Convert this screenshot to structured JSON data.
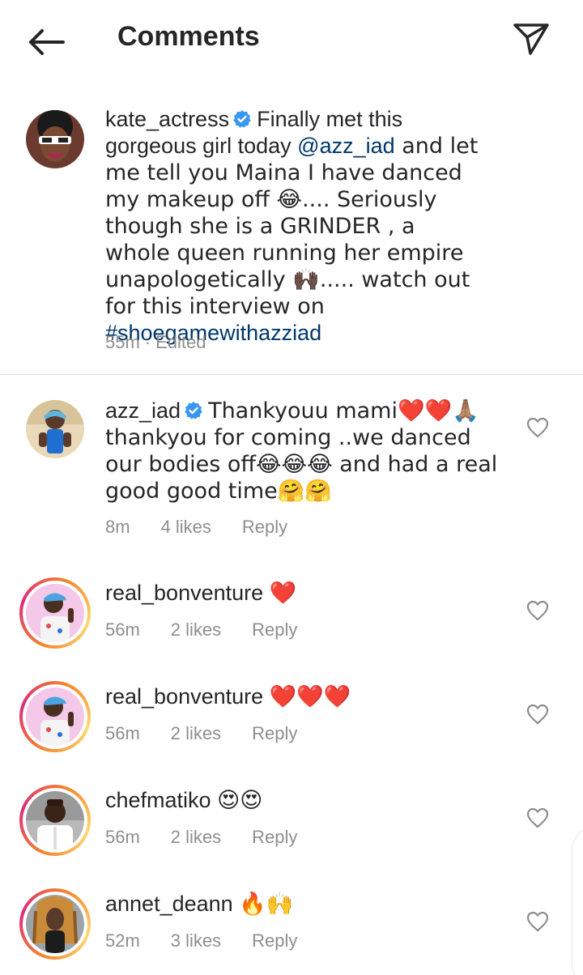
{
  "header": {
    "title": "Comments",
    "back_icon": "arrow-left-icon",
    "share_icon": "paper-plane-icon"
  },
  "caption": {
    "username": "kate_actress",
    "verified": true,
    "text_1": "Finally  met this gorgeous girl today ",
    "mention": "@azz_iad",
    "text_2": " and let me tell you Maina I have danced my makeup off 😂.... Seriously though she is a GRINDER , a whole queen running her empire unapologetically 🙌🏿..... watch out for this interview on ",
    "hashtag": "#shoegamewithazziad",
    "time": "55m",
    "edited": "Edited"
  },
  "comments": [
    {
      "username": "azz_iad",
      "verified": true,
      "text": "Thankyouu mami❤️❤️🙏🏽 thankyou for coming ..we danced our bodies off😂😂😂 and had a real good good time🤗🤗",
      "time": "8m",
      "likes": "4 likes",
      "reply": "Reply"
    },
    {
      "username": "real_bonventure",
      "text": "❤️",
      "time": "56m",
      "likes": "2 likes",
      "reply": "Reply"
    },
    {
      "username": "real_bonventure",
      "text": "❤️❤️❤️",
      "time": "56m",
      "likes": "2 likes",
      "reply": "Reply"
    },
    {
      "username": "chefmatiko",
      "text": "😍😍",
      "time": "56m",
      "likes": "2 likes",
      "reply": "Reply"
    },
    {
      "username": "annet_deann",
      "text": "🔥🙌",
      "time": "52m",
      "likes": "3 likes",
      "reply": "Reply"
    }
  ],
  "colors": {
    "text": "#262626",
    "secondary": "#8e8e8e",
    "link": "#00376b",
    "verified": "#3897f0",
    "heart": "#e0245e"
  }
}
